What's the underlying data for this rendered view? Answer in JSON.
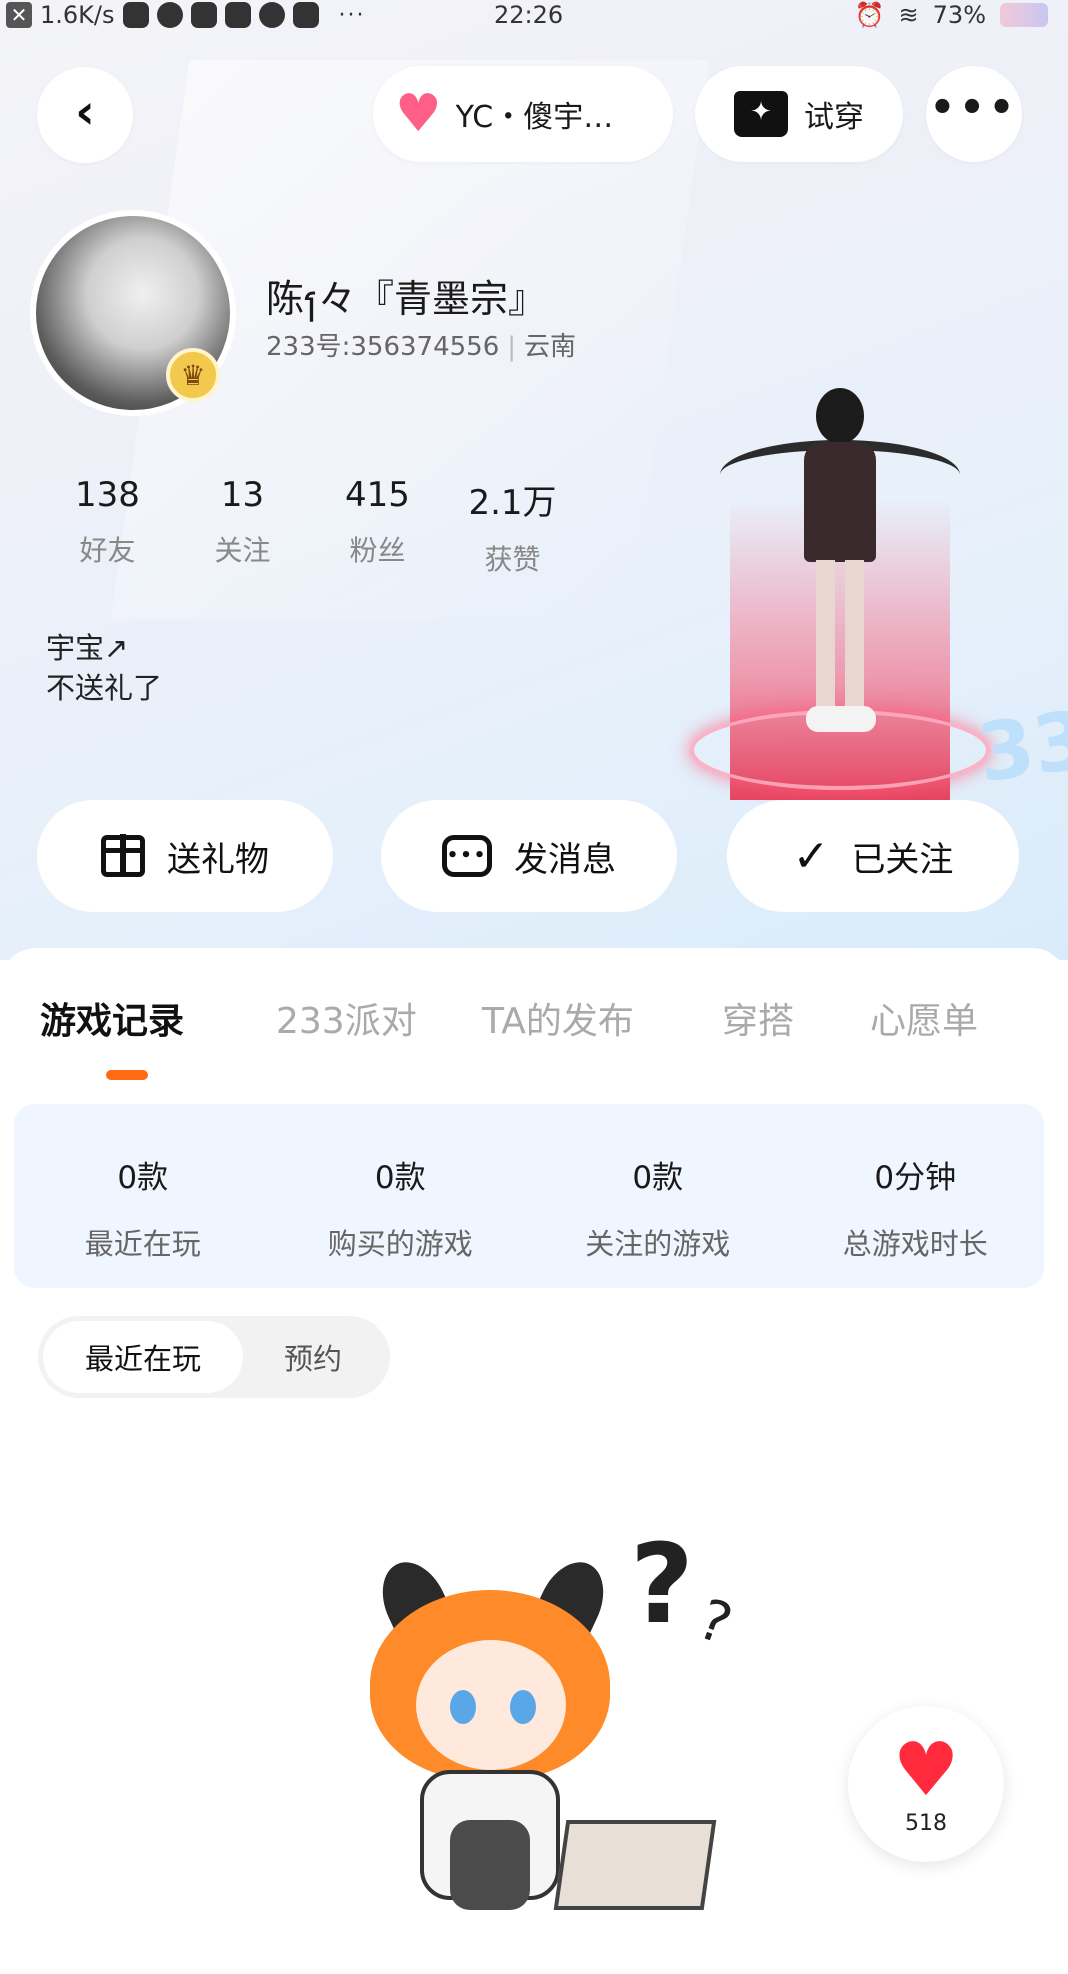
{
  "status_bar": {
    "net_speed": "1.6K/s",
    "dots": "···",
    "time": "22:26",
    "battery": "73%"
  },
  "header": {
    "back_icon": "back-chevron-icon",
    "companion_label": "YC・傻宇…",
    "try_on_label": "试穿",
    "more_icon": "more-dots-icon"
  },
  "profile": {
    "nickname": "陈ⳕ々『青墨宗』",
    "id_line": "233号:356374556",
    "region": "云南",
    "stats": [
      {
        "value": "138",
        "label": "好友"
      },
      {
        "value": "13",
        "label": "关注"
      },
      {
        "value": "415",
        "label": "粉丝"
      },
      {
        "value": "2.1万",
        "label": "获赞"
      }
    ],
    "bio_line1": "宇宝↗",
    "bio_line2": "不送礼了"
  },
  "actions": {
    "gift_label": "送礼物",
    "message_label": "发消息",
    "follow_label": "已关注"
  },
  "tabs": [
    "游戏记录",
    "233派对",
    "TA的发布",
    "穿搭",
    "心愿单"
  ],
  "active_tab": "游戏记录",
  "summary": [
    {
      "value": "0款",
      "label": "最近在玩"
    },
    {
      "value": "0款",
      "label": "购买的游戏"
    },
    {
      "value": "0款",
      "label": "关注的游戏"
    },
    {
      "value": "0分钟",
      "label": "总游戏时长"
    }
  ],
  "segment": {
    "options": [
      "最近在玩",
      "预约"
    ],
    "selected": "最近在玩"
  },
  "like": {
    "count": "518"
  },
  "colors": {
    "accent": "#ff6a13",
    "heart": "#ff2b3c",
    "summary_bg": "#f0f6ff"
  }
}
